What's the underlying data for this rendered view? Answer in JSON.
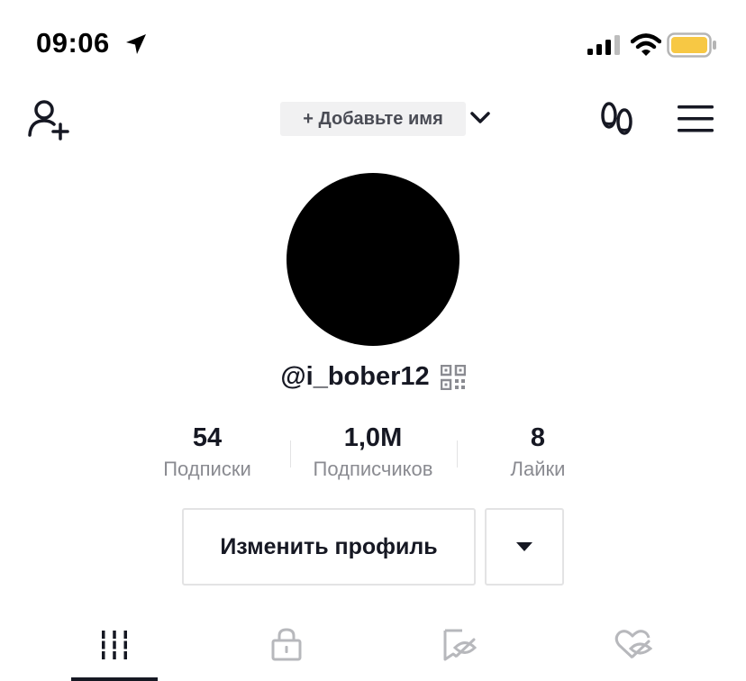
{
  "status_bar": {
    "time": "09:06",
    "icons": [
      "location-arrow-icon",
      "cellular-signal-icon",
      "wifi-icon",
      "battery-icon"
    ],
    "battery_color": "#f7c844"
  },
  "header": {
    "add_name_label": "+ Добавьте имя",
    "icons": [
      "add-friend-icon",
      "chevron-down-icon",
      "footprint-icon",
      "menu-icon"
    ]
  },
  "profile": {
    "username": "@i_bober12",
    "avatar_color": "#000000"
  },
  "stats": [
    {
      "value": "54",
      "label": "Подписки"
    },
    {
      "value": "1,0M",
      "label": "Подписчиков"
    },
    {
      "value": "8",
      "label": "Лайки"
    }
  ],
  "actions": {
    "edit_profile_label": "Изменить профиль",
    "more_icon": "caret-down-icon"
  },
  "tabs": [
    {
      "icon": "videos-grid-icon",
      "selected": true
    },
    {
      "icon": "lock-icon",
      "selected": false
    },
    {
      "icon": "bookmark-hidden-icon",
      "selected": false
    },
    {
      "icon": "heart-hidden-icon",
      "selected": false
    }
  ],
  "colors": {
    "text_primary": "#161823",
    "text_secondary": "#8a8b91",
    "border": "#e3e3e4",
    "pill_bg": "#f1f1f2"
  }
}
